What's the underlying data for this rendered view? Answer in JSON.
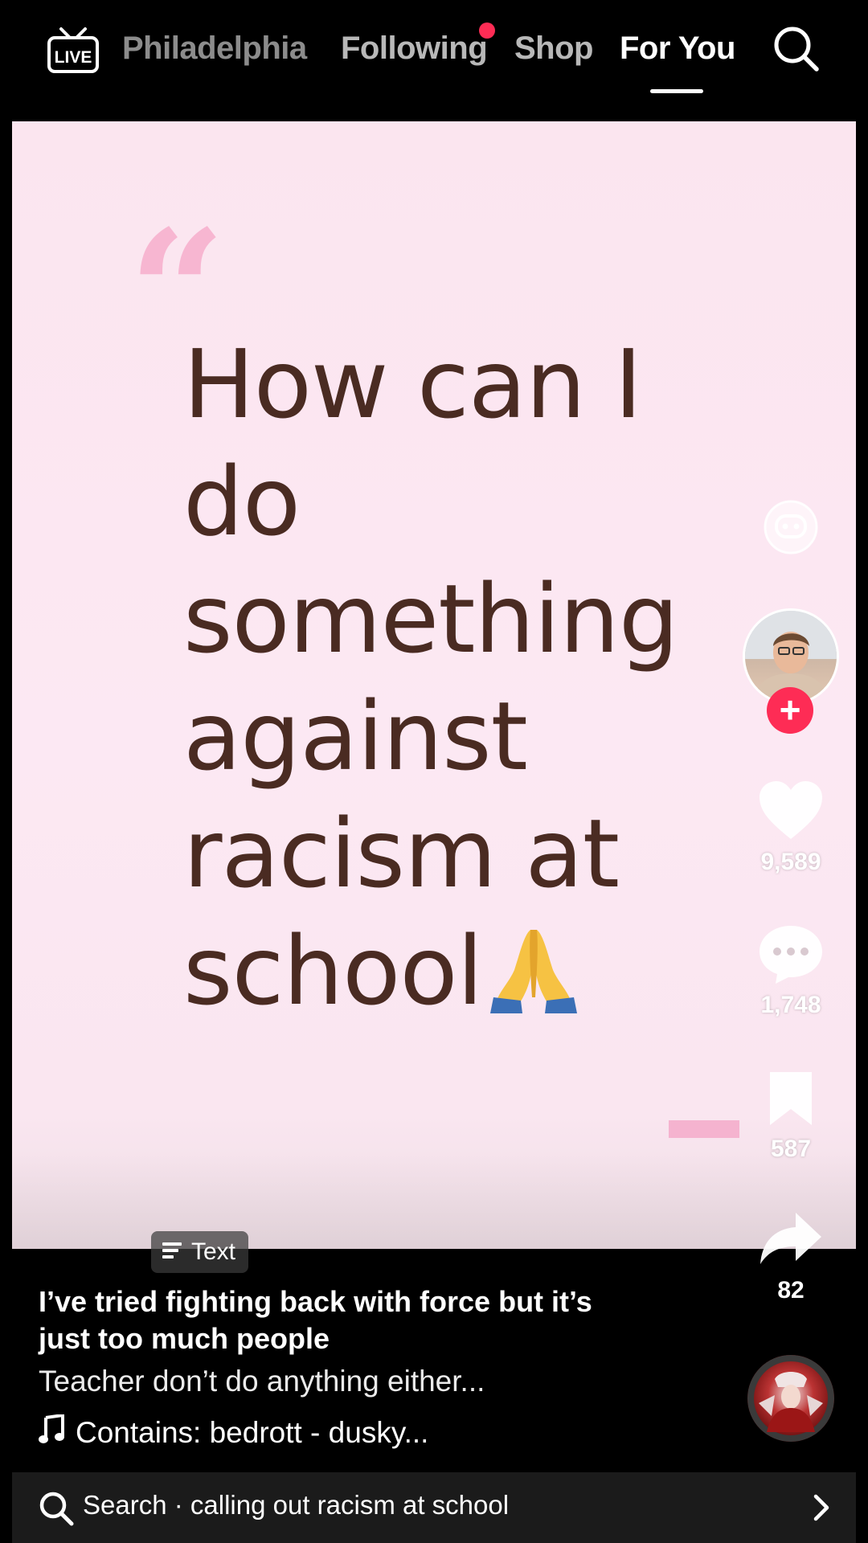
{
  "nav": {
    "live_label": "LIVE",
    "tabs": [
      {
        "label": "Philadelphia"
      },
      {
        "label": "Following",
        "has_notification": true
      },
      {
        "label": "Shop"
      },
      {
        "label": "For You",
        "active": true
      }
    ],
    "search_icon": "search-icon"
  },
  "video": {
    "quote_mark": "“",
    "headline": "How can I do something against racism at school",
    "headline_emoji": "folded-hands-emoji"
  },
  "rail": {
    "ai_icon": "ai-chat-icon",
    "follow_icon": "plus-icon",
    "likes": "9,589",
    "comments": "1,748",
    "saves": "587",
    "shares": "82",
    "music_disc_icon": "music-disc-avatar"
  },
  "caption": {
    "badge": "Text",
    "title": "I’ve tried fighting back with force but it’s just too much people",
    "description": "Teacher don’t do anything either...",
    "music": "Contains: bedrott - dusky..."
  },
  "search_bar": {
    "text": "Search · calling out racism at school"
  },
  "colors": {
    "accent": "#fe2c55",
    "video_bg": "#fce8f3",
    "headline": "#4a2b22",
    "quote": "#f7b6d1"
  }
}
